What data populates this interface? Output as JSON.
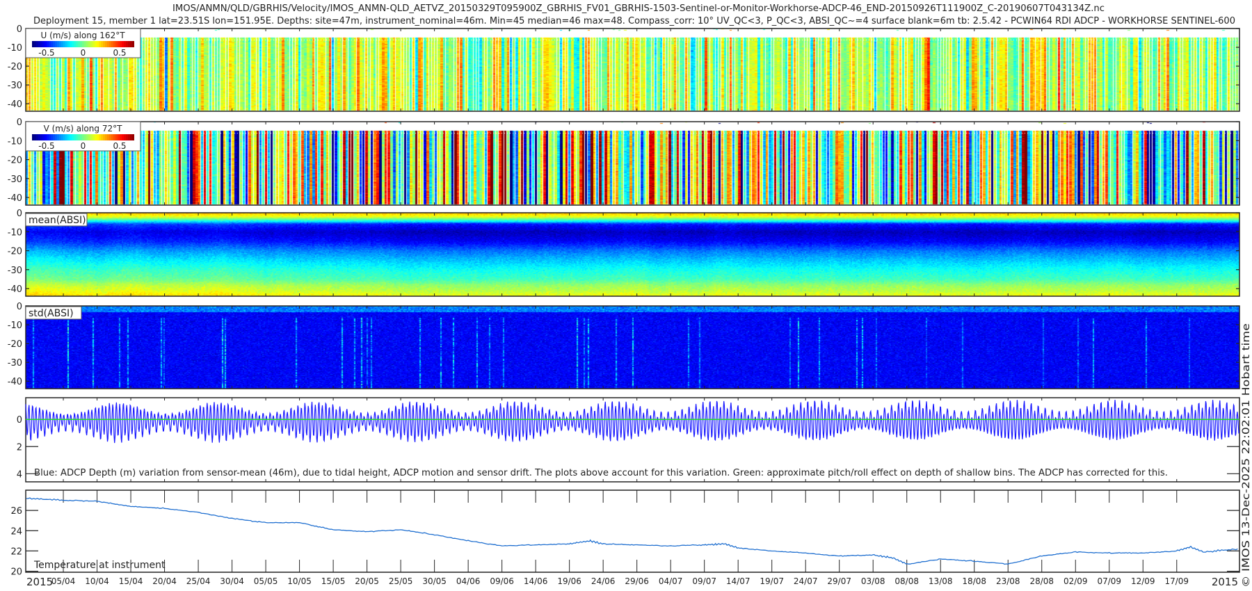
{
  "title_line1": "IMOS/ANMN/QLD/GBRHIS/Velocity/IMOS_ANMN-QLD_AETVZ_20150329T095900Z_GBRHIS_FV01_GBRHIS-1503-Sentinel-or-Monitor-Workhorse-ADCP-46_END-20150926T111900Z_C-20190607T043134Z.nc",
  "title_line2": "Deployment 15, member 1 lat=23.51S lon=151.95E. Depths: site=47m, instrument_nominal=46m. Min=45 median=46 max=48. Compass_corr: 10° UV_QC<3, P_QC<3, ABSI_QC~=4 surface blank=6m tb: 2.5.42 - PCWIN64 RDI ADCP - WORKHORSE SENTINEL-600",
  "side_text": "© IMOS 13-Dec-2025 22:02:01 Hobart time",
  "x_axis": {
    "xlim_doy": [
      89.43,
      269.3
    ],
    "year_left": "2015",
    "year_right": "2015",
    "tick_doy": [
      95,
      100,
      105,
      110,
      115,
      120,
      125,
      130,
      135,
      140,
      145,
      150,
      155,
      160,
      165,
      170,
      175,
      180,
      185,
      190,
      195,
      200,
      205,
      210,
      215,
      220,
      225,
      230,
      235,
      240,
      245,
      250,
      255,
      260
    ],
    "tick_labels": [
      "05/04",
      "10/04",
      "15/04",
      "20/04",
      "25/04",
      "30/04",
      "05/05",
      "10/05",
      "15/05",
      "20/05",
      "25/05",
      "30/05",
      "04/06",
      "09/06",
      "14/06",
      "19/06",
      "24/06",
      "29/06",
      "04/07",
      "09/07",
      "14/07",
      "19/07",
      "24/07",
      "29/07",
      "03/08",
      "08/08",
      "13/08",
      "18/08",
      "23/08",
      "28/08",
      "02/09",
      "07/09",
      "12/09",
      "17/09"
    ]
  },
  "chart_data": [
    {
      "type": "heatmap",
      "name": "U",
      "legend_label": "U (m/s) along 162°T",
      "clim": [
        -0.7,
        0.7
      ],
      "colorbar_ticks": [
        {
          "v": -0.5,
          "label": "-0.5"
        },
        {
          "v": 0,
          "label": "0"
        },
        {
          "v": 0.5,
          "label": "0.5"
        }
      ],
      "ylim": [
        0,
        44
      ],
      "yticks": [
        0,
        10,
        20,
        30,
        40
      ],
      "ytick_labels": [
        "0",
        "-10",
        "-20",
        "-30",
        "-40"
      ],
      "surface_blank_m": 6,
      "typical_value": 0.05,
      "spread": 0.15
    },
    {
      "type": "heatmap",
      "name": "V",
      "legend_label": "V (m/s) along 72°T",
      "clim": [
        -0.7,
        0.7
      ],
      "colorbar_ticks": [
        {
          "v": -0.5,
          "label": "-0.5"
        },
        {
          "v": 0,
          "label": "0"
        },
        {
          "v": 0.5,
          "label": "0.5"
        }
      ],
      "ylim": [
        0,
        44
      ],
      "yticks": [
        0,
        10,
        20,
        30,
        40
      ],
      "ytick_labels": [
        "0",
        "-10",
        "-20",
        "-30",
        "-40"
      ],
      "surface_blank_m": 6,
      "typical_value": 0.0,
      "spread": 0.4
    },
    {
      "type": "heatmap",
      "name": "mean_absi",
      "legend_label": "mean(ABSI)",
      "ylim": [
        0,
        44
      ],
      "yticks": [
        0,
        10,
        20,
        30,
        40
      ],
      "ytick_labels": [
        "0",
        "-10",
        "-20",
        "-30",
        "-40"
      ],
      "profile_depth_m": [
        0,
        2,
        4,
        6,
        10,
        15,
        20,
        25,
        30,
        35,
        38,
        41,
        44
      ],
      "profile_colorval": [
        0.68,
        0.6,
        0.4,
        0.2,
        0.12,
        0.18,
        0.3,
        0.38,
        0.45,
        0.5,
        0.58,
        0.62,
        0.68
      ]
    },
    {
      "type": "heatmap",
      "name": "std_absi",
      "legend_label": "std(ABSI)",
      "ylim": [
        0,
        44
      ],
      "yticks": [
        0,
        10,
        20,
        30,
        40
      ],
      "ytick_labels": [
        "0",
        "-10",
        "-20",
        "-30",
        "-40"
      ],
      "typical_colorval": 0.12
    },
    {
      "type": "line",
      "name": "depth_variation",
      "annotation": "Blue: ADCP Depth (m) variation from sensor-mean (46m), due to tidal height, ADCP motion and sensor drift. The plots above account for this variation. Green: approximate pitch/roll effect on depth of shallow bins. The ADCP has corrected for this.",
      "ylim": [
        -1.6,
        4.6
      ],
      "yreversed": true,
      "yticks": [
        0,
        2,
        4
      ],
      "ytick_labels": [
        "0",
        "2",
        "4"
      ],
      "series": [
        {
          "name": "ADCP depth variation",
          "color": "#1a1aff",
          "tidal_period_h": 12.42,
          "spring_neap_days": 14.77,
          "amplitude_range_m": [
            0.5,
            1.35
          ]
        },
        {
          "name": "pitch/roll effect",
          "color": "#22dd22",
          "value": 0
        }
      ]
    },
    {
      "type": "line",
      "name": "temperature",
      "label": "Temperature at instrument",
      "ylim": [
        19.9,
        28
      ],
      "yticks": [
        20,
        22,
        24,
        26
      ],
      "ytick_labels": [
        "20",
        "22",
        "24",
        "26"
      ],
      "color": "#1f6fd0",
      "x": [
        89.5,
        95,
        100,
        105,
        110,
        115,
        120,
        125,
        130,
        135,
        140,
        145,
        150,
        155,
        160,
        165,
        170,
        173,
        175,
        180,
        185,
        190,
        193,
        195,
        200,
        205,
        210,
        215,
        218,
        220,
        225,
        230,
        235,
        240,
        245,
        250,
        255,
        260,
        262,
        264,
        269.3
      ],
      "y": [
        27.2,
        27.0,
        26.9,
        26.4,
        26.2,
        25.8,
        25.2,
        24.8,
        24.8,
        24.1,
        23.9,
        24.1,
        23.6,
        23.0,
        22.5,
        22.6,
        22.7,
        23.0,
        22.7,
        22.6,
        22.5,
        22.6,
        22.7,
        22.3,
        22.0,
        21.8,
        21.5,
        21.6,
        21.3,
        20.7,
        21.2,
        21.0,
        20.7,
        21.5,
        21.9,
        21.8,
        21.8,
        22.0,
        22.4,
        21.9,
        22.2
      ]
    }
  ]
}
